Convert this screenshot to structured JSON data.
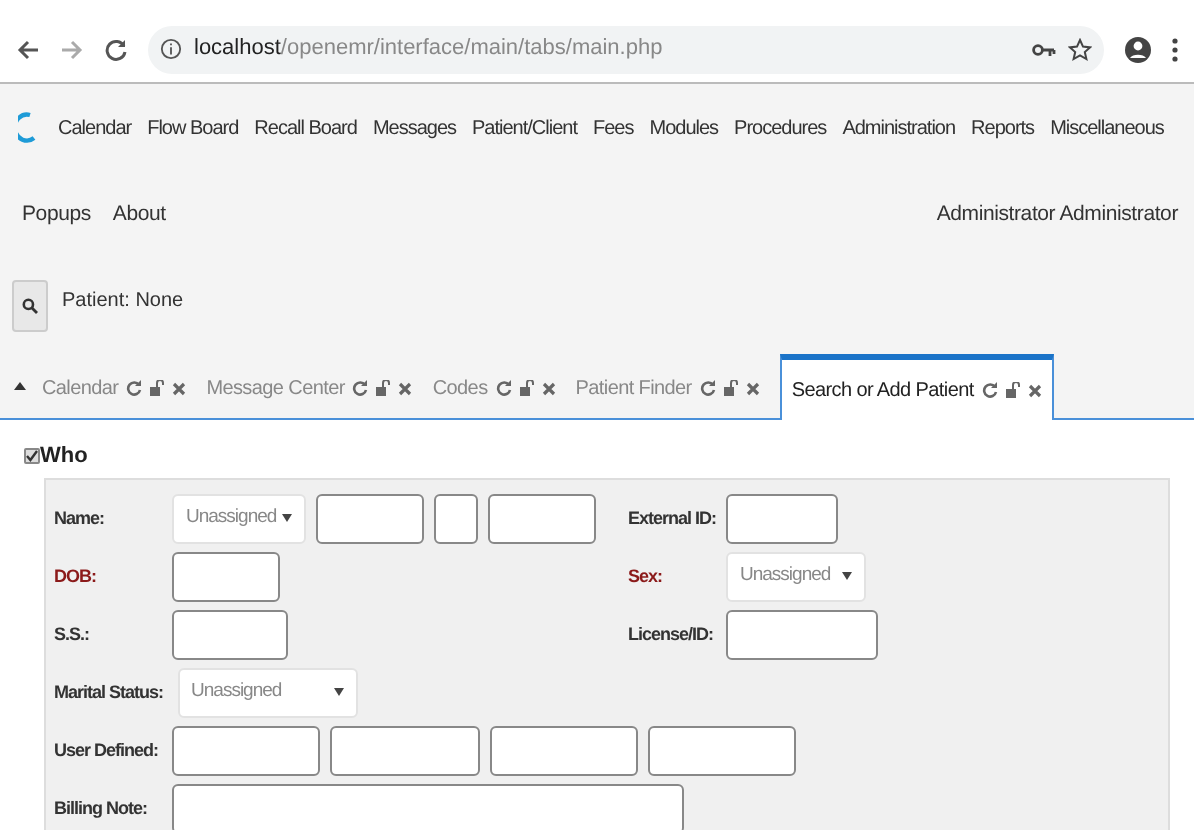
{
  "browser": {
    "url_host": "localhost",
    "url_path": "/openemr/interface/main/tabs/main.php"
  },
  "menu": [
    "Calendar",
    "Flow Board",
    "Recall Board",
    "Messages",
    "Patient/Client",
    "Fees",
    "Modules",
    "Procedures",
    "Administration",
    "Reports",
    "Miscellaneous",
    "Popups",
    "About"
  ],
  "user": "Administrator Administrator",
  "patient": "Patient: None",
  "tabs": [
    {
      "label": "Calendar",
      "selected": false
    },
    {
      "label": "Message Center",
      "selected": false
    },
    {
      "label": "Codes",
      "selected": false
    },
    {
      "label": "Patient Finder",
      "selected": false
    },
    {
      "label": "Search or Add Patient",
      "selected": true
    }
  ],
  "section": {
    "title": "Who",
    "checked": true
  },
  "rows": [
    {
      "left": {
        "label": "Name:",
        "required": false,
        "controls": [
          {
            "kind": "select",
            "value": "Unassigned"
          },
          {
            "kind": "text"
          },
          {
            "kind": "text"
          },
          {
            "kind": "text"
          }
        ]
      },
      "right": {
        "label": "External ID:",
        "required": false,
        "controls": [
          {
            "kind": "text"
          }
        ]
      }
    },
    {
      "left": {
        "label": "DOB:",
        "required": true,
        "controls": [
          {
            "kind": "text"
          }
        ]
      },
      "right": {
        "label": "Sex:",
        "required": true,
        "controls": [
          {
            "kind": "select",
            "value": "Unassigned"
          }
        ]
      }
    },
    {
      "left": {
        "label": "S.S.:",
        "required": false,
        "controls": [
          {
            "kind": "text"
          }
        ]
      },
      "right": {
        "label": "License/ID:",
        "required": false,
        "controls": [
          {
            "kind": "text"
          }
        ]
      }
    },
    {
      "left": {
        "label": "Marital Status:",
        "required": false,
        "controls": [
          {
            "kind": "select",
            "value": "Unassigned"
          }
        ]
      }
    },
    {
      "left": {
        "label": "User Defined:",
        "required": false,
        "controls": [
          {
            "kind": "text"
          },
          {
            "kind": "text"
          },
          {
            "kind": "text"
          },
          {
            "kind": "text"
          }
        ]
      }
    },
    {
      "left": {
        "label": "Billing Note:",
        "required": false,
        "controls": [
          {
            "kind": "text"
          }
        ]
      }
    }
  ]
}
